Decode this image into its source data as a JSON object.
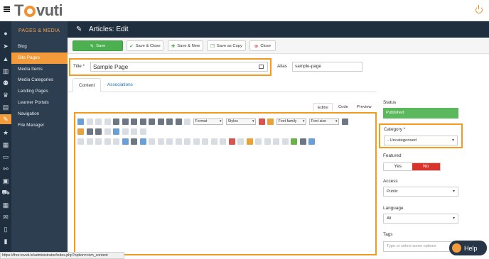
{
  "app": {
    "brand": "Tovuti",
    "brand_color": "#f39a3a"
  },
  "sidebar": {
    "section_title": "PAGES & MEDIA",
    "items": [
      {
        "label": "Blog"
      },
      {
        "label": "Site Pages",
        "active": true
      },
      {
        "label": "Media Items"
      },
      {
        "label": "Media Categories"
      },
      {
        "label": "Landing Pages"
      },
      {
        "label": "Learner Portals"
      },
      {
        "label": "Navigation"
      },
      {
        "label": "File Manager"
      }
    ]
  },
  "header": {
    "title": "Articles: Edit"
  },
  "toolbar": {
    "save": "Save",
    "save_close": "Save & Close",
    "save_new": "Save & New",
    "save_copy": "Save as Copy",
    "close": "Close"
  },
  "form": {
    "title_label": "Title *",
    "title_value": "Sample Page",
    "alias_label": "Alias",
    "alias_value": "sample-page"
  },
  "tabs": {
    "content": "Content",
    "associations": "Associations"
  },
  "editor": {
    "tabs": [
      "Editor",
      "Code",
      "Preview"
    ],
    "format": "Format",
    "styles": "Styles",
    "font_family": "Font family",
    "font_size": "Font size"
  },
  "right_panel": {
    "status_label": "Status",
    "status_value": "Published",
    "category_label": "Category *",
    "category_value": "- Uncategorised",
    "featured_label": "Featured",
    "featured_yes": "Yes",
    "featured_no": "No",
    "access_label": "Access",
    "access_value": "Public",
    "language_label": "Language",
    "language_value": "All",
    "tags_label": "Tags",
    "tags_placeholder": "Type or select some options"
  },
  "help": {
    "label": "Help"
  },
  "browser_status": {
    "url": "https://thor.tovuti.io/administrator/index.php?option=com_content"
  }
}
